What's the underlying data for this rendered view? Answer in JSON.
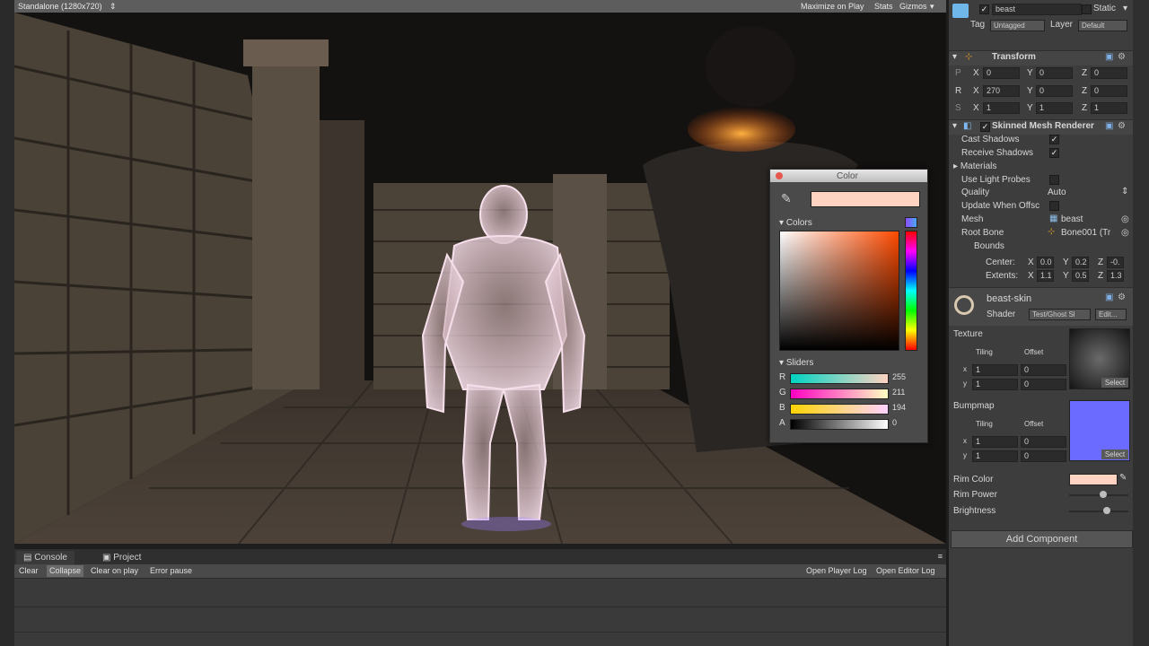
{
  "game_view": {
    "resolution": "Standalone (1280x720)",
    "maximize_label": "Maximize on Play",
    "stats_label": "Stats",
    "gizmos_label": "Gizmos"
  },
  "console": {
    "tabs": [
      "Console",
      "Project"
    ],
    "toolbar_left": [
      "Clear",
      "Collapse",
      "Clear on play",
      "Error pause"
    ],
    "toolbar_right": [
      "Open Player Log",
      "Open Editor Log"
    ]
  },
  "color_picker": {
    "title": "Color",
    "swatch_color": "#ffd3c2",
    "colors_section": "Colors",
    "sliders_section": "Sliders",
    "channels": [
      {
        "label": "R",
        "value": "255"
      },
      {
        "label": "G",
        "value": "211"
      },
      {
        "label": "B",
        "value": "194"
      },
      {
        "label": "A",
        "value": "0"
      }
    ]
  },
  "inspector": {
    "object_name": "beast",
    "static_label": "Static",
    "tag_label": "Tag",
    "tag_value": "Untagged",
    "layer_label": "Layer",
    "layer_value": "Default",
    "transform": {
      "title": "Transform",
      "position": {
        "x": "0",
        "y": "0",
        "z": "0"
      },
      "rotation": {
        "x": "270",
        "y": "0",
        "z": "0"
      },
      "scale": {
        "x": "1",
        "y": "1",
        "z": "1"
      }
    },
    "renderer": {
      "title": "Skinned Mesh Renderer",
      "cast_shadows": "Cast Shadows",
      "receive_shadows": "Receive Shadows",
      "materials": "Materials",
      "use_light_probes": "Use Light Probes",
      "quality_label": "Quality",
      "quality_value": "Auto",
      "update_offscreen": "Update When Offsc",
      "mesh_label": "Mesh",
      "mesh_value": "beast",
      "root_bone_label": "Root Bone",
      "root_bone_value": "Bone001 (Tr",
      "bounds": "Bounds",
      "center_label": "Center:",
      "center": {
        "x": "0.0",
        "y": "0.2",
        "z": "-0."
      },
      "extents_label": "Extents:",
      "extents": {
        "x": "1.1",
        "y": "0.5",
        "z": "1.3"
      }
    },
    "material": {
      "name": "beast-skin",
      "shader_label": "Shader",
      "shader_value": "Test/Ghost Sl",
      "edit_label": "Edit...",
      "texture_label": "Texture",
      "bumpmap_label": "Bumpmap",
      "tiling_label": "Tiling",
      "offset_label": "Offset",
      "tex_tiling": {
        "x": "1",
        "y": "1"
      },
      "tex_offset": {
        "x": "0",
        "y": "0"
      },
      "bump_tiling": {
        "x": "1",
        "y": "1"
      },
      "bump_offset": {
        "x": "0",
        "y": "0"
      },
      "select_label": "Select",
      "rim_color_label": "Rim Color",
      "rim_color": "#ffd3c2",
      "rim_power_label": "Rim Power",
      "rim_power": 0.55,
      "brightness_label": "Brightness",
      "brightness": 0.62
    },
    "add_component": "Add Component"
  }
}
